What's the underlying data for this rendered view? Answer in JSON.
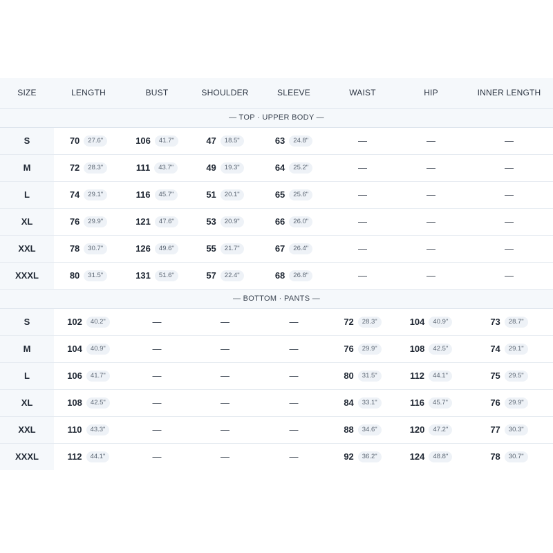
{
  "columns": [
    "SIZE",
    "LENGTH",
    "BUST",
    "SHOULDER",
    "SLEEVE",
    "WAIST",
    "HIP",
    "INNER LENGTH"
  ],
  "sections": [
    {
      "title": "— TOP · UPPER BODY —",
      "rows": [
        {
          "size": "S",
          "cells": [
            [
              "70",
              "27.6\""
            ],
            [
              "106",
              "41.7\""
            ],
            [
              "47",
              "18.5\""
            ],
            [
              "63",
              "24.8\""
            ],
            null,
            null,
            null
          ]
        },
        {
          "size": "M",
          "cells": [
            [
              "72",
              "28.3\""
            ],
            [
              "111",
              "43.7\""
            ],
            [
              "49",
              "19.3\""
            ],
            [
              "64",
              "25.2\""
            ],
            null,
            null,
            null
          ]
        },
        {
          "size": "L",
          "cells": [
            [
              "74",
              "29.1\""
            ],
            [
              "116",
              "45.7\""
            ],
            [
              "51",
              "20.1\""
            ],
            [
              "65",
              "25.6\""
            ],
            null,
            null,
            null
          ]
        },
        {
          "size": "XL",
          "cells": [
            [
              "76",
              "29.9\""
            ],
            [
              "121",
              "47.6\""
            ],
            [
              "53",
              "20.9\""
            ],
            [
              "66",
              "26.0\""
            ],
            null,
            null,
            null
          ]
        },
        {
          "size": "XXL",
          "cells": [
            [
              "78",
              "30.7\""
            ],
            [
              "126",
              "49.6\""
            ],
            [
              "55",
              "21.7\""
            ],
            [
              "67",
              "26.4\""
            ],
            null,
            null,
            null
          ]
        },
        {
          "size": "XXXL",
          "cells": [
            [
              "80",
              "31.5\""
            ],
            [
              "131",
              "51.6\""
            ],
            [
              "57",
              "22.4\""
            ],
            [
              "68",
              "26.8\""
            ],
            null,
            null,
            null
          ]
        }
      ]
    },
    {
      "title": "— BOTTOM · PANTS —",
      "rows": [
        {
          "size": "S",
          "cells": [
            [
              "102",
              "40.2\""
            ],
            null,
            null,
            null,
            [
              "72",
              "28.3\""
            ],
            [
              "104",
              "40.9\""
            ],
            [
              "73",
              "28.7\""
            ]
          ]
        },
        {
          "size": "M",
          "cells": [
            [
              "104",
              "40.9\""
            ],
            null,
            null,
            null,
            [
              "76",
              "29.9\""
            ],
            [
              "108",
              "42.5\""
            ],
            [
              "74",
              "29.1\""
            ]
          ]
        },
        {
          "size": "L",
          "cells": [
            [
              "106",
              "41.7\""
            ],
            null,
            null,
            null,
            [
              "80",
              "31.5\""
            ],
            [
              "112",
              "44.1\""
            ],
            [
              "75",
              "29.5\""
            ]
          ]
        },
        {
          "size": "XL",
          "cells": [
            [
              "108",
              "42.5\""
            ],
            null,
            null,
            null,
            [
              "84",
              "33.1\""
            ],
            [
              "116",
              "45.7\""
            ],
            [
              "76",
              "29.9\""
            ]
          ]
        },
        {
          "size": "XXL",
          "cells": [
            [
              "110",
              "43.3\""
            ],
            null,
            null,
            null,
            [
              "88",
              "34.6\""
            ],
            [
              "120",
              "47.2\""
            ],
            [
              "77",
              "30.3\""
            ]
          ]
        },
        {
          "size": "XXXL",
          "cells": [
            [
              "112",
              "44.1\""
            ],
            null,
            null,
            null,
            [
              "92",
              "36.2\""
            ],
            [
              "124",
              "48.8\""
            ],
            [
              "78",
              "30.7\""
            ]
          ]
        }
      ]
    }
  ],
  "empty_mark": "—"
}
